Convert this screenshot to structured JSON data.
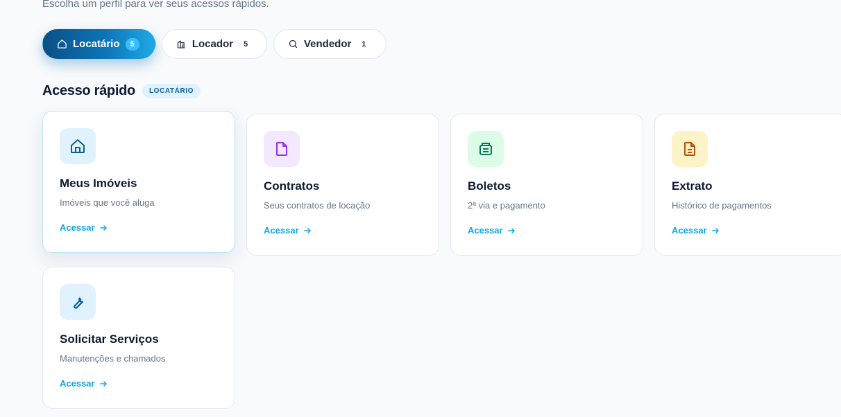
{
  "header": {
    "subtitle": "Escolha um perfil para ver seus acessos rápidos."
  },
  "tabs": [
    {
      "label": "Locatário",
      "count": "5",
      "icon": "home-icon",
      "active": true
    },
    {
      "label": "Locador",
      "count": "5",
      "icon": "building-icon",
      "active": false
    },
    {
      "label": "Vendedor",
      "count": "1",
      "icon": "search-icon",
      "active": false
    }
  ],
  "section": {
    "title": "Acesso rápido",
    "badge": "LOCATÁRIO"
  },
  "cards": [
    {
      "title": "Meus Imóveis",
      "description": "Imóveis que você aluga",
      "link": "Acessar",
      "icon": "home-icon",
      "icon_color": "#0b5f96",
      "icon_bg": "#e0f2fe"
    },
    {
      "title": "Contratos",
      "description": "Seus contratos de locação",
      "link": "Acessar",
      "icon": "document-icon",
      "icon_color": "#9333ea",
      "icon_bg": "#f3e8ff"
    },
    {
      "title": "Boletos",
      "description": "2ª via e pagamento",
      "link": "Acessar",
      "icon": "receipt-icon",
      "icon_color": "#047857",
      "icon_bg": "#dcfce7"
    },
    {
      "title": "Extrato",
      "description": "Histórico de pagamentos",
      "link": "Acessar",
      "icon": "file-text-icon",
      "icon_color": "#b45309",
      "icon_bg": "#fef3c7"
    },
    {
      "title": "Solicitar Serviços",
      "description": "Manutenções e chamados",
      "link": "Acessar",
      "icon": "wrench-icon",
      "icon_color": "#0b5f96",
      "icon_bg": "#e0f2fe"
    }
  ]
}
